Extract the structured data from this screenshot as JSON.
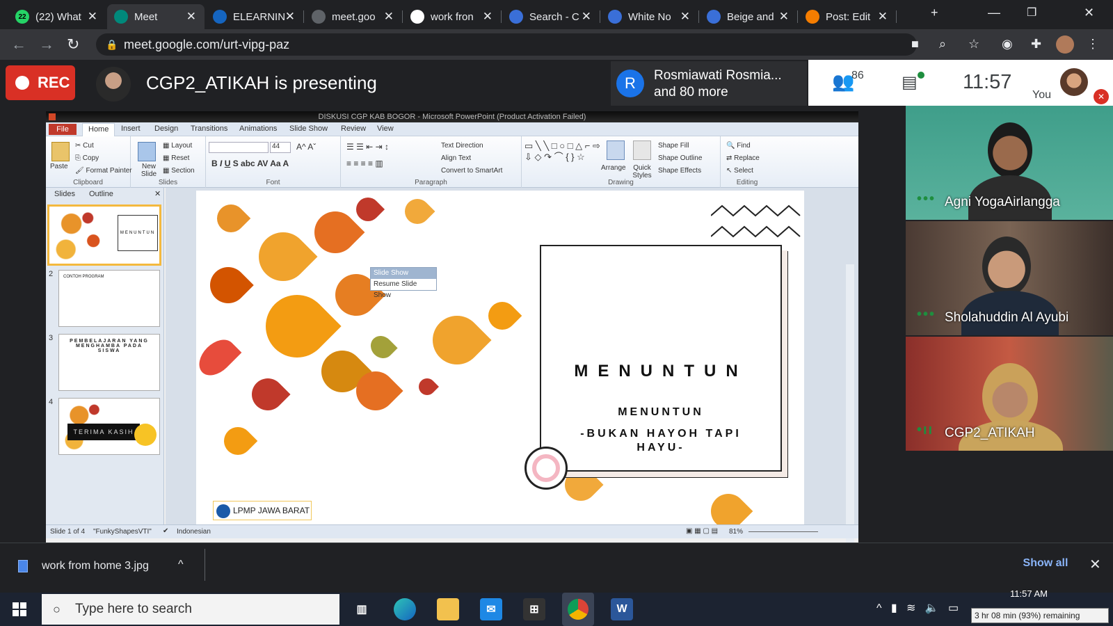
{
  "browser": {
    "tabs": [
      {
        "title": "(22) What",
        "icon": "whatsapp-icon",
        "color": "#25d366",
        "badge": "22"
      },
      {
        "title": "Meet",
        "icon": "meet-icon",
        "color": "#00897b"
      },
      {
        "title": "ELEARNIN",
        "icon": "elearning-icon",
        "color": "#1565c0"
      },
      {
        "title": "meet.goo",
        "icon": "globe-icon",
        "color": "#5f6368"
      },
      {
        "title": "work fron",
        "icon": "google-icon",
        "color": "#ffffff"
      },
      {
        "title": "Search - C",
        "icon": "canva-icon",
        "color": "#3a6fd8"
      },
      {
        "title": "White No",
        "icon": "canva-icon",
        "color": "#3a6fd8"
      },
      {
        "title": "Beige and",
        "icon": "canva-icon",
        "color": "#3a6fd8"
      },
      {
        "title": "Post: Edit",
        "icon": "blogger-icon",
        "color": "#f57d00"
      }
    ],
    "url": "meet.google.com/urt-vipg-paz"
  },
  "meet": {
    "rec_label": "REC",
    "presenting": "CGP2_ATIKAH is presenting",
    "join_avatar": "R",
    "join_line1": "Rosmiawati Rosmia...",
    "join_line2": "and 80 more",
    "participant_count": "86",
    "time": "11:57",
    "you_label": "You",
    "tiles": [
      {
        "name": "Agni YogaAirlangga"
      },
      {
        "name": "Sholahuddin Al Ayubi"
      },
      {
        "name": "CGP2_ATIKAH"
      }
    ]
  },
  "ppt": {
    "window_title": "DISKUSI CGP KAB BOGOR - Microsoft PowerPoint (Product Activation Failed)",
    "tabs": [
      "File",
      "Home",
      "Insert",
      "Design",
      "Transitions",
      "Animations",
      "Slide Show",
      "Review",
      "View"
    ],
    "clipboard": {
      "paste": "Paste",
      "cut": "Cut",
      "copy": "Copy",
      "format_painter": "Format Painter",
      "label": "Clipboard"
    },
    "slides_group": {
      "new_slide": "New Slide",
      "layout": "Layout",
      "reset": "Reset",
      "section": "Section",
      "label": "Slides"
    },
    "font_group": {
      "size": "44",
      "label": "Font"
    },
    "paragraph_group": {
      "text_direction": "Text Direction",
      "align_text": "Align Text",
      "convert": "Convert to SmartArt",
      "label": "Paragraph"
    },
    "drawing_group": {
      "arrange": "Arrange",
      "quick_styles": "Quick Styles",
      "shape_fill": "Shape Fill",
      "shape_outline": "Shape Outline",
      "shape_effects": "Shape Effects",
      "label": "Drawing"
    },
    "editing_group": {
      "find": "Find",
      "replace": "Replace",
      "select": "Select",
      "label": "Editing"
    },
    "panel_tabs": [
      "Slides",
      "Outline"
    ],
    "thumbs": [
      {
        "num": "1",
        "text": "MENUNTUN"
      },
      {
        "num": "2",
        "text": "CONTOH PROGRAM"
      },
      {
        "num": "3",
        "text": "PEMBELAJARAN YANG MENGHAMBA PADA SISWA"
      },
      {
        "num": "4",
        "text": "TERIMA KASIH"
      }
    ],
    "slideshow_menu": {
      "header": "Slide Show",
      "item": "Resume Slide Show"
    },
    "slide": {
      "title": "MENUNTUN",
      "subtitle": "MENUNTUN",
      "tagline": "-BUKAN HAYOH TAPI HAYU-",
      "logo_text": "LPMP JAWA BARAT"
    },
    "status": {
      "slide": "Slide 1 of 4",
      "theme": "\"FunkyShapesVTI\"",
      "language": "Indonesian",
      "zoom": "81%"
    }
  },
  "downloads": {
    "file": "work from home 3.jpg",
    "show_all": "Show all"
  },
  "taskbar": {
    "search_placeholder": "Type here to search",
    "clock": "11:57 AM",
    "battery_tip": "3 hr 08 min (93%) remaining"
  }
}
